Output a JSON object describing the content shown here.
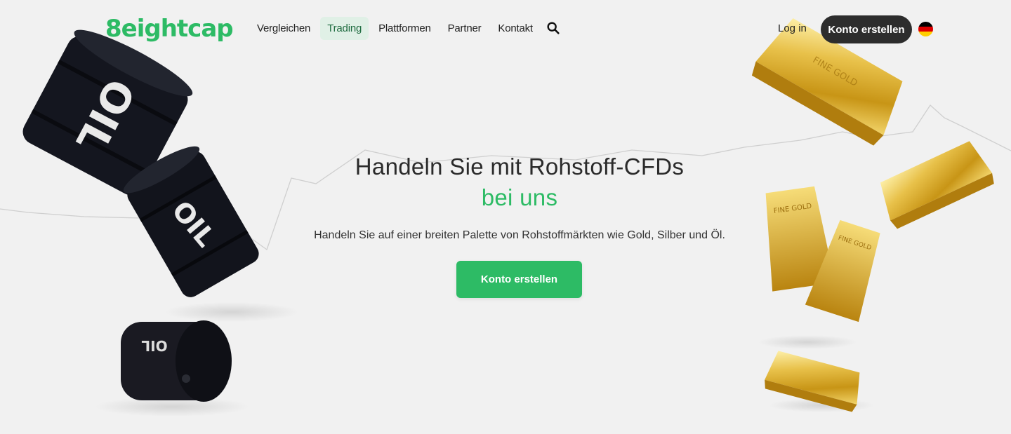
{
  "header": {
    "logo_text": "8eightcap",
    "nav": [
      {
        "label": "Vergleichen",
        "active": false
      },
      {
        "label": "Trading",
        "active": true
      },
      {
        "label": "Plattformen",
        "active": false
      },
      {
        "label": "Partner",
        "active": false
      },
      {
        "label": "Kontakt",
        "active": false
      }
    ],
    "login_label": "Log in",
    "cta_label": "Konto erstellen",
    "language_flag": "de-flag-icon"
  },
  "hero": {
    "title_line1": "Handeln Sie mit Rohstoff-CFDs",
    "title_line2": "bei uns",
    "subtitle": "Handeln Sie auf einer breiten Palette von Rohstoffmärkten wie Gold, Silber und Öl.",
    "cta_label": "Konto erstellen"
  },
  "decor": {
    "barrel_label": "OIL",
    "bar_label": "FINE GOLD"
  },
  "colors": {
    "brand_green": "#2dbb65",
    "dark_button": "#2d2d2d",
    "background": "#f1f1f1"
  }
}
